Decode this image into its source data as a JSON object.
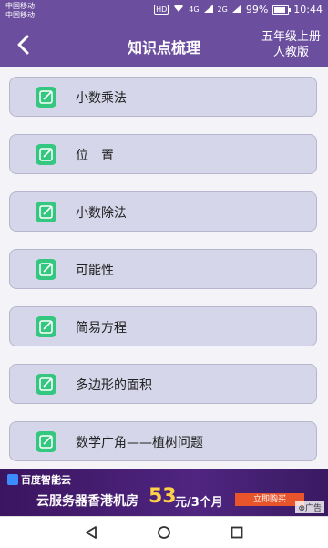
{
  "status": {
    "carrier1": "中国移动",
    "carrier2": "中国移动",
    "network": "HD",
    "sig1": "4G",
    "sig2": "2G",
    "battery": "99%",
    "time": "10:44"
  },
  "header": {
    "title": "知识点梳理",
    "grade_line1": "五年级上册",
    "grade_line2": "人教版"
  },
  "topics": [
    {
      "label": "小数乘法",
      "icon": "edit-square-icon"
    },
    {
      "label": "位　置",
      "icon": "edit-square-icon"
    },
    {
      "label": "小数除法",
      "icon": "edit-square-icon"
    },
    {
      "label": "可能性",
      "icon": "edit-square-icon"
    },
    {
      "label": "简易方程",
      "icon": "edit-square-icon"
    },
    {
      "label": "多边形的面积",
      "icon": "edit-square-icon"
    },
    {
      "label": "数学广角——植树问题",
      "icon": "edit-square-icon"
    }
  ],
  "ad": {
    "brand": "百度智能云",
    "text": "云服务器香港机房",
    "price": "53",
    "unit": "元/3个月",
    "cta": "立即购买",
    "ad_tag": "⊗广告"
  },
  "colors": {
    "header_bg": "#6b4f9e",
    "item_bg": "#d6d6ea",
    "icon_green": "#33c77f"
  }
}
